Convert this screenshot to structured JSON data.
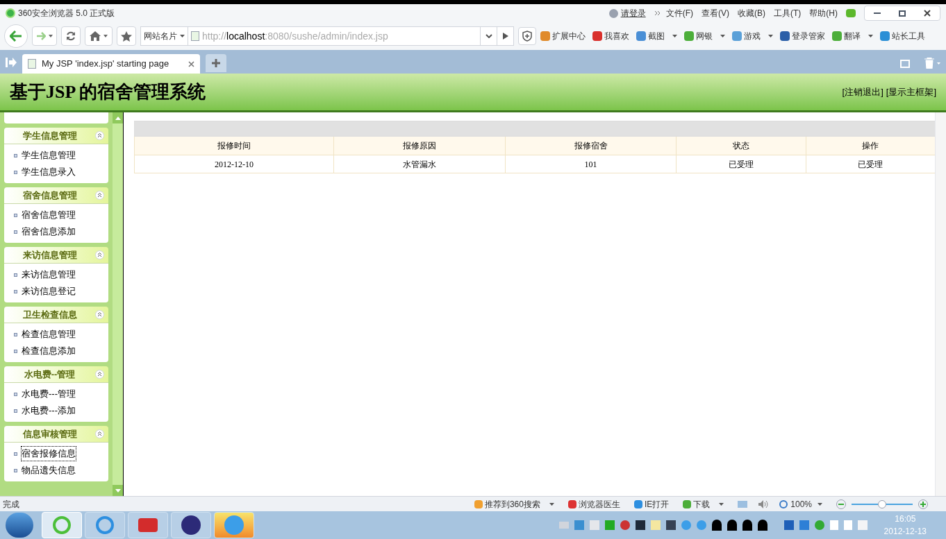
{
  "window": {
    "title": "360安全浏览器 5.0 正式版",
    "login": "请登录",
    "menu": [
      "文件(F)",
      "查看(V)",
      "收藏(B)",
      "工具(T)",
      "帮助(H)"
    ]
  },
  "address_bar": {
    "site_card": "网站名片",
    "url": "http://**localhost**:8080/sushe/admin/index.jsp"
  },
  "toolbar": [
    {
      "label": "扩展中心",
      "dropdown": false
    },
    {
      "label": "我喜欢",
      "dropdown": false
    },
    {
      "label": "截图",
      "dropdown": true
    },
    {
      "label": "网银",
      "dropdown": true
    },
    {
      "label": "游戏",
      "dropdown": true
    },
    {
      "label": "登录管家",
      "dropdown": false
    },
    {
      "label": "翻译",
      "dropdown": true
    },
    {
      "label": "站长工具",
      "dropdown": false
    }
  ],
  "tabs": [
    {
      "label": "My JSP 'index.jsp' starting page",
      "selected": true
    }
  ],
  "header": {
    "title": "基于JSP 的宿舍管理系统",
    "links": [
      "[注销退出]",
      "[显示主框架]"
    ]
  },
  "sidebar": [
    {
      "title": "学生信息管理",
      "items": [
        {
          "label": "学生信息管理",
          "selected": false
        },
        {
          "label": "学生信息录入",
          "selected": false
        }
      ]
    },
    {
      "title": "宿舍信息管理",
      "items": [
        {
          "label": "宿舍信息管理",
          "selected": false
        },
        {
          "label": "宿舍信息添加",
          "selected": false
        }
      ]
    },
    {
      "title": "来访信息管理",
      "items": [
        {
          "label": "来访信息管理",
          "selected": false
        },
        {
          "label": "来访信息登记",
          "selected": false
        }
      ]
    },
    {
      "title": "卫生检查信息",
      "items": [
        {
          "label": "检查信息管理",
          "selected": false
        },
        {
          "label": "检查信息添加",
          "selected": false
        }
      ]
    },
    {
      "title": "水电费--管理",
      "items": [
        {
          "label": "水电费---管理",
          "selected": false
        },
        {
          "label": "水电费---添加",
          "selected": false
        }
      ]
    },
    {
      "title": "信息审核管理",
      "items": [
        {
          "label": "宿舍报修信息",
          "selected": true
        },
        {
          "label": "物品遗失信息",
          "selected": false
        }
      ]
    }
  ],
  "table": {
    "columns": [
      "报修时间",
      "报修原因",
      "报修宿舍",
      "状态",
      "操作"
    ],
    "rows": [
      [
        "2012-12-10",
        "水管漏水",
        "101",
        "已受理",
        "已受理"
      ]
    ]
  },
  "status_bar": {
    "status": "完成",
    "items": [
      {
        "label": "推荐到360搜索",
        "dropdown": true
      },
      {
        "label": "浏览器医生",
        "dropdown": false
      },
      {
        "label": "IE打开",
        "dropdown": false
      },
      {
        "label": "下载",
        "dropdown": true
      }
    ],
    "zoom": "100%",
    "zoom_slider": {
      "level": 0.5
    }
  },
  "taskbar": {
    "time": "16:05",
    "date": "2012-12-13"
  }
}
